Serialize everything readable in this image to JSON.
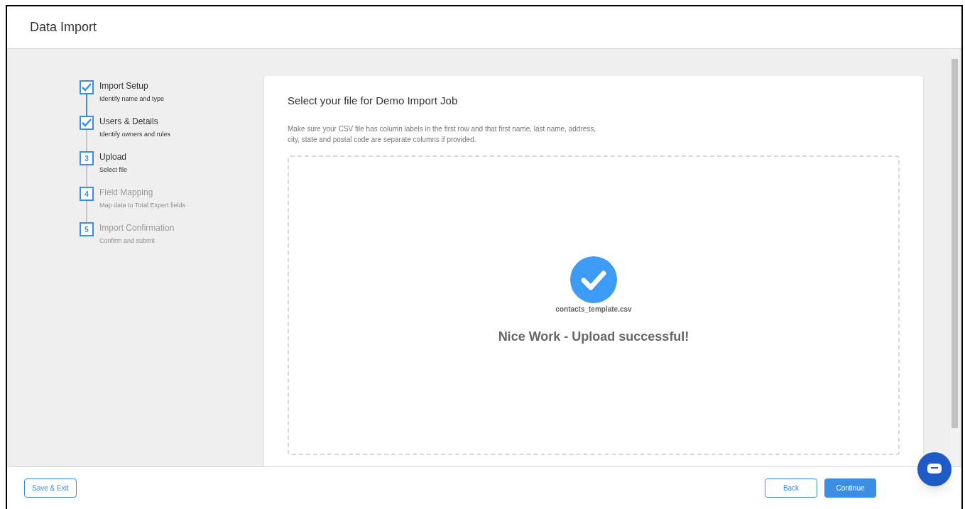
{
  "header": {
    "title": "Data Import"
  },
  "steps": [
    {
      "title": "Import Setup",
      "subtitle": "Identify name and type",
      "done": true,
      "disabled": false
    },
    {
      "title": "Users & Details",
      "subtitle": "Identify owners and rules",
      "done": true,
      "disabled": false
    },
    {
      "number": "3",
      "title": "Upload",
      "subtitle": "Select file",
      "done": false,
      "disabled": false
    },
    {
      "number": "4",
      "title": "Field Mapping",
      "subtitle": "Map data to Total Expert fields",
      "done": false,
      "disabled": true
    },
    {
      "number": "5",
      "title": "Import Confirmation",
      "subtitle": "Confirm and submit",
      "done": false,
      "disabled": true
    }
  ],
  "card": {
    "title": "Select your file for Demo Import Job",
    "instructions": "Make sure your CSV file has column labels in the first row and that first name, last name, address, city, state and postal code are separate columns if provided.",
    "file_name": "contacts_template.csv",
    "message": "Nice Work - Upload successful!"
  },
  "footer": {
    "save_exit": "Save & Exit",
    "back": "Back",
    "continue": "Continue"
  }
}
